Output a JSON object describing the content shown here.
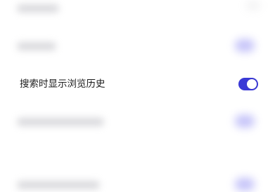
{
  "settings": {
    "rows": [
      {
        "label": "",
        "toggle_on": false,
        "visible": false
      },
      {
        "label": "",
        "toggle_on": true,
        "visible": false
      },
      {
        "label": "搜索时显示浏览历史",
        "toggle_on": true,
        "visible": true
      },
      {
        "label": "",
        "toggle_on": true,
        "visible": false
      },
      {
        "label": "",
        "toggle_on": true,
        "visible": false
      }
    ]
  },
  "colors": {
    "toggle_on": "#3a39d6",
    "knob": "#ffffff",
    "label_text": "#1a1a1a"
  }
}
